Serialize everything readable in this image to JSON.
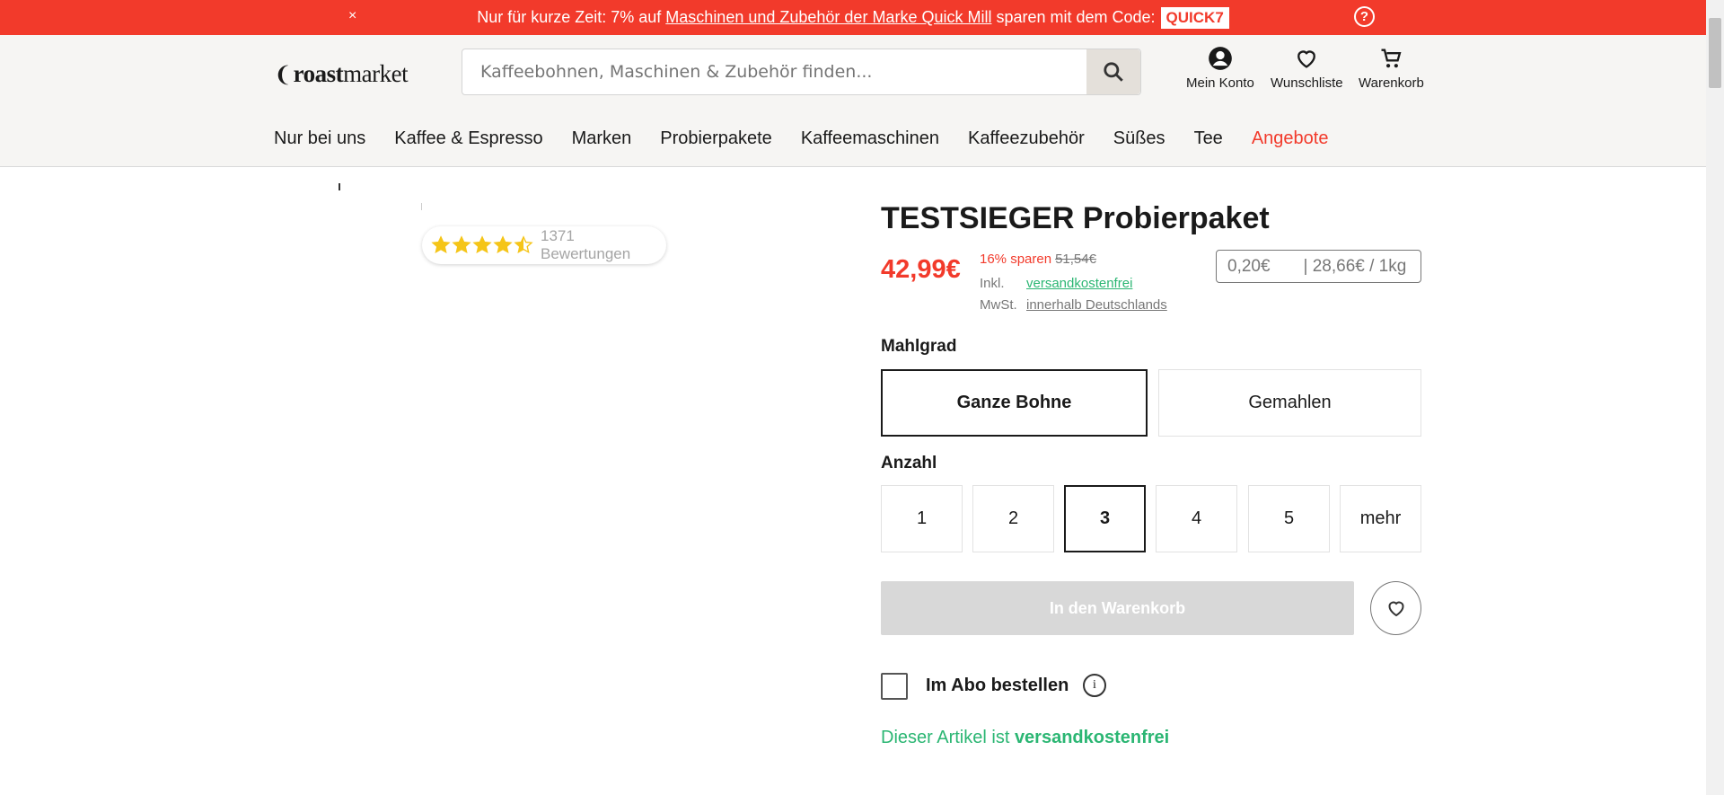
{
  "promo": {
    "close": "×",
    "prefix": "Nur für kurze Zeit: 7% auf ",
    "link": "Maschinen und Zubehör der Marke Quick Mill",
    "suffix": " sparen mit dem Code:",
    "code": "QUICK7",
    "help": "?"
  },
  "header": {
    "logo_bold": "roast",
    "logo_rest": "market",
    "search_placeholder": "Kaffeebohnen, Maschinen & Zubehör finden...",
    "account": "Mein Konto",
    "wishlist": "Wunschliste",
    "cart": "Warenkorb"
  },
  "nav": [
    "Nur bei uns",
    "Kaffee & Espresso",
    "Marken",
    "Probierpakete",
    "Kaffeemaschinen",
    "Kaffeezubehör",
    "Süßes",
    "Tee",
    "Angebote"
  ],
  "product": {
    "rating_value": 4.5,
    "rating_text": "1371 Bewertungen",
    "title": "TESTSIEGER Probierpaket",
    "price": "42,99€",
    "save": "16% sparen",
    "old_price": "51,54€",
    "inkl": "Inkl.",
    "mwst": "MwSt.",
    "shipping_free": "versandkostenfrei",
    "shipping_region": "innerhalb Deutschlands",
    "unit_price": "0,20€       | 28,66€ / 1kg",
    "grind_label": "Mahlgrad",
    "grind_options": [
      "Ganze Bohne",
      "Gemahlen"
    ],
    "grind_selected": "Ganze Bohne",
    "qty_label": "Anzahl",
    "qty_options": [
      "1",
      "2",
      "3",
      "4",
      "5",
      "mehr"
    ],
    "qty_selected": "3",
    "add_to_cart": "In den Warenkorb",
    "abo_label": "Im Abo bestellen",
    "info": "i",
    "free_prefix": "Dieser Artikel ist ",
    "free_bold": "versandkostenfrei"
  },
  "colors": {
    "accent": "#f23a2b",
    "green": "#2bb673",
    "star": "#f5c518"
  }
}
